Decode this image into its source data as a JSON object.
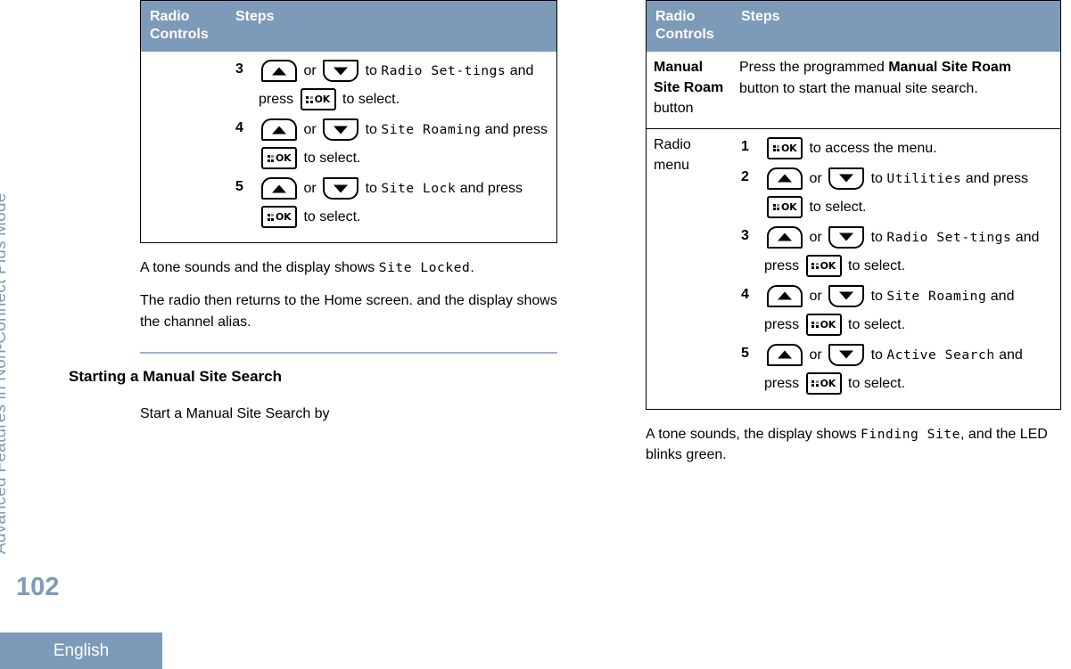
{
  "running_head": "Advanced Features in Non-Connect Plus Mode",
  "page_number": "102",
  "language_tab": "English",
  "icons": {
    "up_key": "up-arrow-key-icon",
    "down_key": "down-arrow-key-icon",
    "ok_key": "menu-ok-key-icon"
  },
  "left_column": {
    "table": {
      "headers": {
        "controls": "Radio Controls",
        "steps": "Steps"
      },
      "rows": [
        {
          "control": "",
          "start_number": 3,
          "steps": [
            {
              "parts": [
                {
                  "t": "key",
                  "v": "up"
                },
                {
                  "t": "text",
                  "v": " or "
                },
                {
                  "t": "key",
                  "v": "down"
                },
                {
                  "t": "text",
                  "v": " to "
                },
                {
                  "t": "lcd",
                  "v": "Radio Set-tings"
                },
                {
                  "t": "text",
                  "v": " and press "
                },
                {
                  "t": "key",
                  "v": "ok"
                },
                {
                  "t": "text",
                  "v": " to select."
                }
              ]
            },
            {
              "parts": [
                {
                  "t": "key",
                  "v": "up"
                },
                {
                  "t": "text",
                  "v": " or "
                },
                {
                  "t": "key",
                  "v": "down"
                },
                {
                  "t": "text",
                  "v": " to "
                },
                {
                  "t": "lcd",
                  "v": "Site Roaming"
                },
                {
                  "t": "text",
                  "v": " and press "
                },
                {
                  "t": "key",
                  "v": "ok"
                },
                {
                  "t": "text",
                  "v": " to select."
                }
              ]
            },
            {
              "parts": [
                {
                  "t": "key",
                  "v": "up"
                },
                {
                  "t": "text",
                  "v": " or "
                },
                {
                  "t": "key",
                  "v": "down"
                },
                {
                  "t": "text",
                  "v": " to "
                },
                {
                  "t": "lcd",
                  "v": "Site Lock"
                },
                {
                  "t": "text",
                  "v": " and press "
                },
                {
                  "t": "key",
                  "v": "ok"
                },
                {
                  "t": "text",
                  "v": " to select."
                }
              ]
            }
          ]
        }
      ]
    },
    "paragraph_1_pre": "A tone sounds and the display shows ",
    "paragraph_1_lcd": "Site Locked",
    "paragraph_1_post": ".",
    "paragraph_2": "The radio then returns to the Home screen. and the display shows the channel alias.",
    "section_heading": "Starting a Manual Site Search",
    "section_body": "Start a Manual Site Search by"
  },
  "right_column": {
    "table": {
      "headers": {
        "controls": "Radio Controls",
        "steps": "Steps"
      },
      "rows": [
        {
          "control_bold": "Manual Site Roam",
          "control_plain": "button",
          "body_pre": "Press the programmed ",
          "body_bold": "Manual Site Roam",
          "body_post": " button to start the manual site search."
        },
        {
          "control_plain": "Radio menu",
          "start_number": 1,
          "steps": [
            {
              "parts": [
                {
                  "t": "key",
                  "v": "ok"
                },
                {
                  "t": "text",
                  "v": " to access the menu."
                }
              ]
            },
            {
              "parts": [
                {
                  "t": "key",
                  "v": "up"
                },
                {
                  "t": "text",
                  "v": " or "
                },
                {
                  "t": "key",
                  "v": "down"
                },
                {
                  "t": "text",
                  "v": " to "
                },
                {
                  "t": "lcd",
                  "v": "Utilities"
                },
                {
                  "t": "text",
                  "v": " and press "
                },
                {
                  "t": "key",
                  "v": "ok"
                },
                {
                  "t": "text",
                  "v": " to select."
                }
              ]
            },
            {
              "parts": [
                {
                  "t": "key",
                  "v": "up"
                },
                {
                  "t": "text",
                  "v": " or "
                },
                {
                  "t": "key",
                  "v": "down"
                },
                {
                  "t": "text",
                  "v": " to "
                },
                {
                  "t": "lcd",
                  "v": "Radio Set-tings"
                },
                {
                  "t": "text",
                  "v": " and press "
                },
                {
                  "t": "key",
                  "v": "ok"
                },
                {
                  "t": "text",
                  "v": " to select."
                }
              ]
            },
            {
              "parts": [
                {
                  "t": "key",
                  "v": "up"
                },
                {
                  "t": "text",
                  "v": " or "
                },
                {
                  "t": "key",
                  "v": "down"
                },
                {
                  "t": "text",
                  "v": " to "
                },
                {
                  "t": "lcd",
                  "v": "Site Roaming"
                },
                {
                  "t": "text",
                  "v": " and press "
                },
                {
                  "t": "key",
                  "v": "ok"
                },
                {
                  "t": "text",
                  "v": " to select."
                }
              ]
            },
            {
              "parts": [
                {
                  "t": "key",
                  "v": "up"
                },
                {
                  "t": "text",
                  "v": " or "
                },
                {
                  "t": "key",
                  "v": "down"
                },
                {
                  "t": "text",
                  "v": " to "
                },
                {
                  "t": "lcd",
                  "v": "Active Search"
                },
                {
                  "t": "text",
                  "v": " and press "
                },
                {
                  "t": "key",
                  "v": "ok"
                },
                {
                  "t": "text",
                  "v": " to select."
                }
              ]
            }
          ]
        }
      ]
    },
    "paragraph_1_pre": "A tone sounds, the display shows ",
    "paragraph_1_lcd": "Finding Site",
    "paragraph_1_post": ", and the LED blinks green."
  },
  "colors": {
    "accent": "#7d9ab8",
    "rule": "#9fb3c8",
    "text": "#000000"
  }
}
